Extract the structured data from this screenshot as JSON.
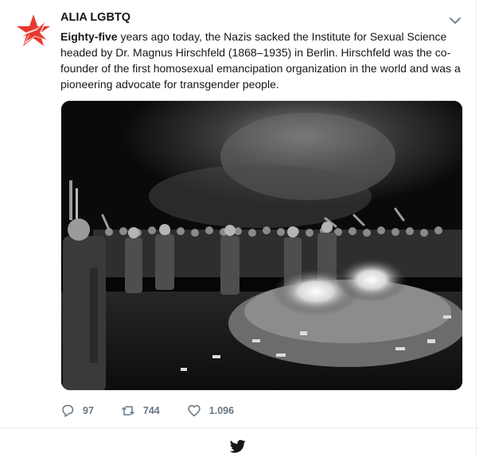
{
  "tweet": {
    "author": "ALIA LGBTQ",
    "text_lead": "Eighty-five",
    "text_rest": " years ago today, the Nazis sacked the Institute for Sexual Science headed by Dr. Magnus Hirschfeld (1868–1935) in Berlin. Hirschfeld was the co-founder of the first homosexual emancipation organization in the world and was a pioneering advocate for transgender people."
  },
  "actions": {
    "replies": "97",
    "retweets": "744",
    "likes": "1.096"
  },
  "icons": {
    "avatar": "alia-star-logo",
    "menu": "chevron-down-icon",
    "reply": "reply-icon",
    "retweet": "retweet-icon",
    "like": "heart-icon",
    "footer": "twitter-bird-icon"
  },
  "colors": {
    "logo_red": "#e8392f",
    "icon_gray": "#657786",
    "twitter_bird": "#14171a"
  }
}
